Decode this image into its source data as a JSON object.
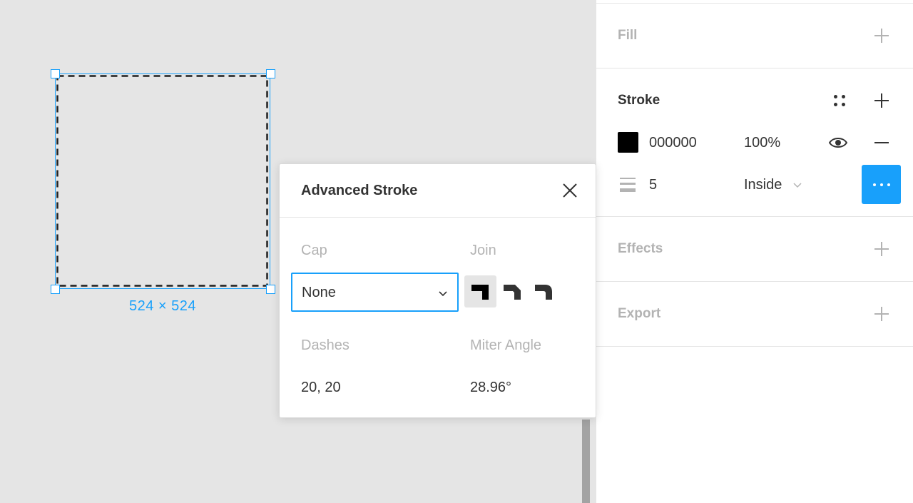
{
  "canvas": {
    "selection_size": "524 × 524"
  },
  "panel": {
    "fill": {
      "title": "Fill"
    },
    "stroke": {
      "title": "Stroke",
      "color_hex": "000000",
      "opacity": "100%",
      "weight": "5",
      "position": "Inside"
    },
    "effects": {
      "title": "Effects"
    },
    "export": {
      "title": "Export"
    }
  },
  "advanced_stroke": {
    "title": "Advanced Stroke",
    "cap_label": "Cap",
    "cap_value": "None",
    "join_label": "Join",
    "join_options": [
      "miter-join-icon",
      "bevel-join-icon",
      "round-join-icon"
    ],
    "join_selected": "miter-join-icon",
    "dashes_label": "Dashes",
    "dashes_value": "20, 20",
    "miter_label": "Miter Angle",
    "miter_value": "28.96°"
  },
  "colors": {
    "accent": "#18a0fb",
    "canvas_bg": "#e5e5e5",
    "swatch": "#000000"
  }
}
